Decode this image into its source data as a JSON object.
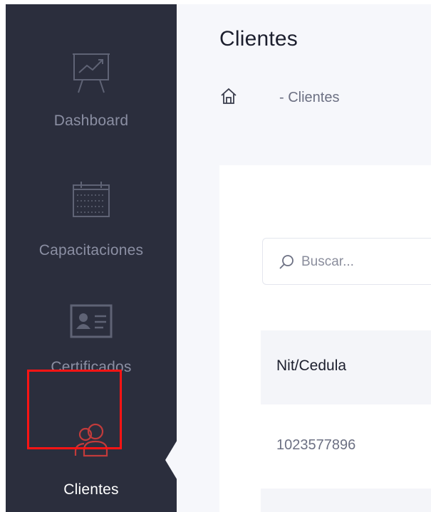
{
  "sidebar": {
    "items": [
      {
        "label": "Dashboard",
        "icon": "presentation-chart-icon",
        "active": false
      },
      {
        "label": "Capacitaciones",
        "icon": "calendar-icon",
        "active": false
      },
      {
        "label": "Certificados",
        "icon": "id-card-icon",
        "active": false
      },
      {
        "label": "Clientes",
        "icon": "users-icon",
        "active": true
      }
    ],
    "colors": {
      "background": "#2b2e3d",
      "inactive_text": "#8b8fa3",
      "active_icon": "#c23b3b"
    }
  },
  "header": {
    "title": "Clientes",
    "breadcrumb": {
      "icon": "home-icon",
      "text": "- Clientes"
    }
  },
  "search": {
    "placeholder": "Buscar...",
    "value": ""
  },
  "table": {
    "columns": [
      "Nit/Cedula"
    ],
    "rows": [
      [
        "1023577896"
      ]
    ]
  },
  "annotation": {
    "color": "#ff1414"
  }
}
